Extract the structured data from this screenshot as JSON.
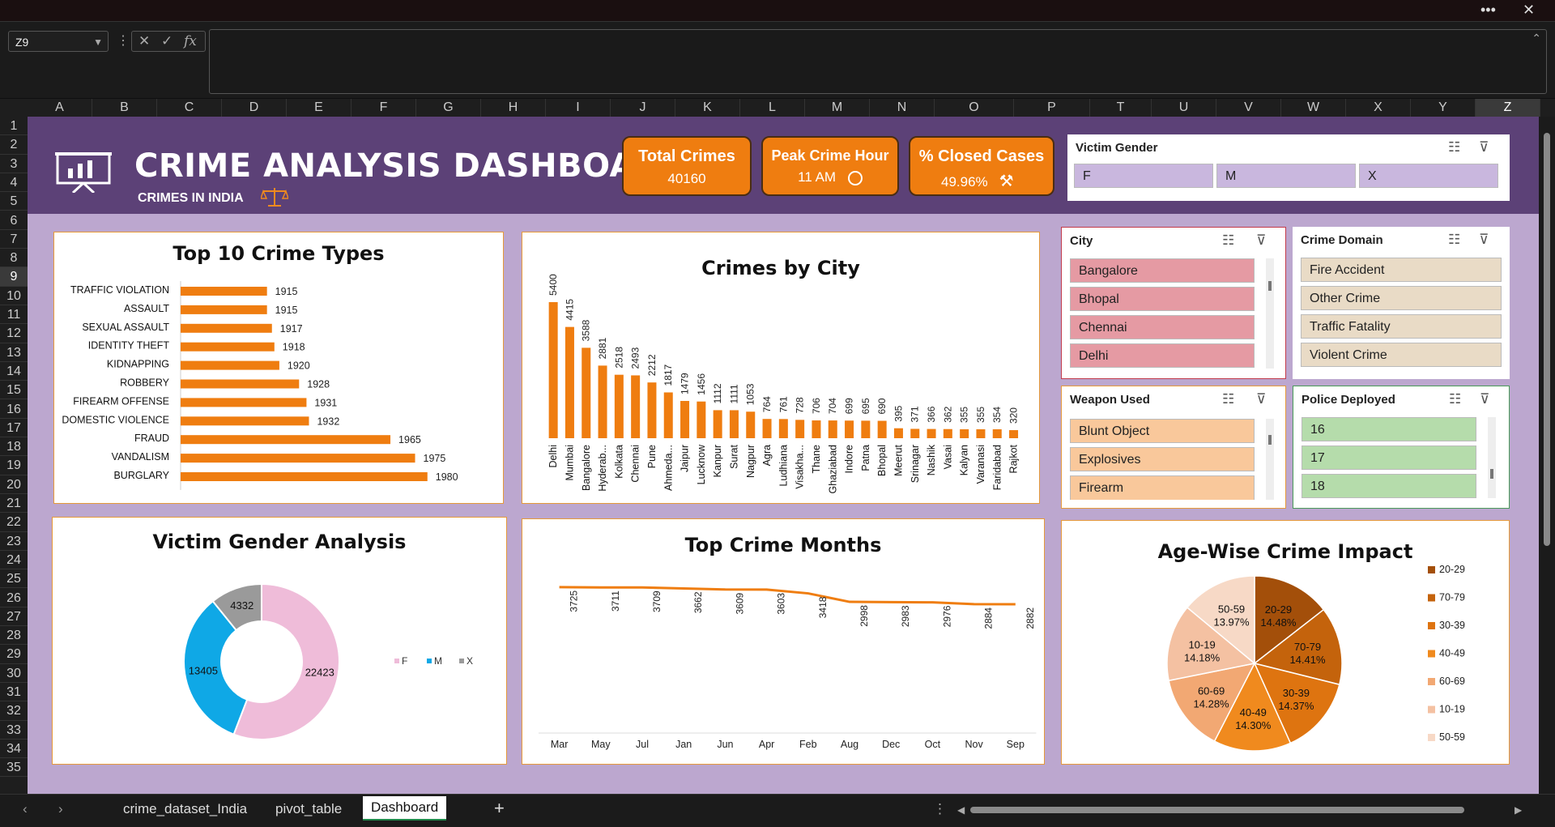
{
  "window": {
    "more_label": "•••",
    "close_label": "✕"
  },
  "formula_bar": {
    "name_box": "Z9",
    "cancel": "✕",
    "enter": "✓",
    "fx": "fx",
    "value": ""
  },
  "columns": [
    "A",
    "B",
    "C",
    "D",
    "E",
    "F",
    "G",
    "H",
    "I",
    "J",
    "K",
    "L",
    "M",
    "N",
    "O",
    "P",
    "T",
    "U",
    "V",
    "W",
    "X",
    "Y",
    "Z"
  ],
  "rows": [
    "1",
    "2",
    "3",
    "4",
    "5",
    "6",
    "7",
    "8",
    "9",
    "10",
    "11",
    "12",
    "13",
    "14",
    "15",
    "16",
    "17",
    "18",
    "19",
    "20",
    "21",
    "22",
    "23",
    "24",
    "25",
    "26",
    "27",
    "28",
    "29",
    "30",
    "31",
    "32",
    "33",
    "34",
    "35"
  ],
  "dashboard": {
    "title": "CRIME ANALYSIS DASHBOARD",
    "subtitle": "CRIMES IN INDIA",
    "kpis": [
      {
        "label": "Total Crimes",
        "value": "40160"
      },
      {
        "label": "Peak Crime Hour",
        "value": "11 AM"
      },
      {
        "label": "% Closed Cases",
        "value": "49.96%"
      }
    ]
  },
  "slicers": {
    "victim_gender": {
      "title": "Victim Gender",
      "items": [
        "F",
        "M",
        "X"
      ]
    },
    "city": {
      "title": "City",
      "items": [
        "Bangalore",
        "Bhopal",
        "Chennai",
        "Delhi"
      ]
    },
    "crime_domain": {
      "title": "Crime Domain",
      "items": [
        "Fire Accident",
        "Other Crime",
        "Traffic Fatality",
        "Violent Crime"
      ]
    },
    "weapon_used": {
      "title": "Weapon Used",
      "items": [
        "Blunt Object",
        "Explosives",
        "Firearm"
      ]
    },
    "police_deployed": {
      "title": "Police Deployed",
      "items": [
        "16",
        "17",
        "18"
      ]
    }
  },
  "colors": {
    "orange": "#ef7d10",
    "banner": "#5c4177",
    "sheet": "#bca7cf",
    "female": "#efbcd9",
    "male": "#0fa8e6",
    "other": "#9a9a9a"
  },
  "chart_data": [
    {
      "type": "bar",
      "title": "Top 10 Crime Types",
      "orientation": "horizontal",
      "categories": [
        "TRAFFIC VIOLATION",
        "ASSAULT",
        "SEXUAL ASSAULT",
        "IDENTITY THEFT",
        "KIDNAPPING",
        "ROBBERY",
        "FIREARM OFFENSE",
        "DOMESTIC VIOLENCE",
        "FRAUD",
        "VANDALISM",
        "BURGLARY"
      ],
      "values": [
        1915,
        1915,
        1917,
        1918,
        1920,
        1928,
        1931,
        1932,
        1965,
        1975,
        1980
      ],
      "xlim": [
        1880,
        1985
      ]
    },
    {
      "type": "bar",
      "title": "Crimes by City",
      "categories": [
        "Delhi",
        "Mumbai",
        "Bangalore",
        "Hyderab...",
        "Kolkata",
        "Chennai",
        "Pune",
        "Ahmeda...",
        "Jaipur",
        "Lucknow",
        "Kanpur",
        "Surat",
        "Nagpur",
        "Agra",
        "Ludhiana",
        "Visakha...",
        "Thane",
        "Ghaziabad",
        "Indore",
        "Patna",
        "Bhopal",
        "Meerut",
        "Srinagar",
        "Nashik",
        "Vasai",
        "Kalyan",
        "Varanasi",
        "Faridabad",
        "Rajkot"
      ],
      "values": [
        5400,
        4415,
        3588,
        2881,
        2518,
        2493,
        2212,
        1817,
        1479,
        1456,
        1112,
        1111,
        1053,
        764,
        761,
        728,
        706,
        704,
        699,
        695,
        690,
        395,
        371,
        366,
        362,
        355,
        355,
        354,
        320
      ],
      "ylim": [
        0,
        5400
      ]
    },
    {
      "type": "pie",
      "title": "Victim Gender Analysis",
      "donut": true,
      "labels": [
        "F",
        "M",
        "X"
      ],
      "values": [
        22423,
        13405,
        4332
      ]
    },
    {
      "type": "line",
      "title": "Top Crime Months",
      "categories": [
        "Mar",
        "May",
        "Jul",
        "Jan",
        "Jun",
        "Apr",
        "Feb",
        "Aug",
        "Dec",
        "Oct",
        "Nov",
        "Sep"
      ],
      "values": [
        3725,
        3711,
        3709,
        3662,
        3609,
        3603,
        3418,
        2998,
        2983,
        2976,
        2884,
        2882
      ],
      "ylim": [
        0,
        3800
      ]
    },
    {
      "type": "pie",
      "title": "Age-Wise Crime Impact",
      "labels": [
        "20-29",
        "70-79",
        "30-39",
        "40-49",
        "60-69",
        "10-19",
        "50-59"
      ],
      "values": [
        14.48,
        14.41,
        14.37,
        14.3,
        14.28,
        14.18,
        13.97
      ],
      "value_labels": [
        "14.48%",
        "14.41%",
        "14.37%",
        "14.30%",
        "14.28%",
        "14.18%",
        "13.97%"
      ],
      "colors": [
        "#a34f0a",
        "#c4630c",
        "#de7410",
        "#f08a1e",
        "#f2a873",
        "#f4c1a2",
        "#f7d9c6"
      ]
    }
  ],
  "sheet_tabs": [
    "crime_dataset_India",
    "pivot_table",
    "Dashboard"
  ],
  "active_tab": "Dashboard",
  "add_sheet": "+"
}
